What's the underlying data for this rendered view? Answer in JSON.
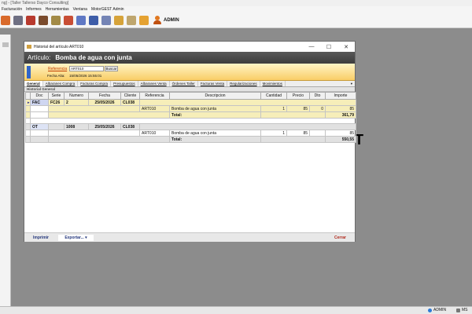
{
  "app": {
    "title_fragment": "ng] - [Taller Tallerso Dayco Consulting]",
    "menu": [
      "Facturación",
      "Informes",
      "Herramientas",
      "Ventana",
      "MotorGEST Admin"
    ],
    "user_label": "ADMIN",
    "background_letter": "T"
  },
  "statusbar": {
    "user": "ADMIN",
    "host": "MS"
  },
  "dialog": {
    "window_title": "Historial del artículo ART010",
    "controls": [
      "—",
      "☐",
      "✕"
    ],
    "article_label": "Artículo:",
    "article_name": "Bomba de agua con junta",
    "reference_label": "Referencia",
    "reference_value": "ART010",
    "search_label": "Buscar",
    "date_label": "Fecha Alta:",
    "date_value": "15/05/2026 15:55:01",
    "tabs": [
      "General",
      "Albaranes Compra",
      "Facturas Compra",
      "Presupuestos",
      "Albaranes Venta",
      "Órdenes Taller",
      "Facturas Venta",
      "Regularizaciones",
      "Movimientos"
    ],
    "tab_dropdown": "▾",
    "section_title": "Historial General",
    "columns": [
      "Doc",
      "Serie",
      "Numero",
      "Fecha",
      "Cliente",
      "Referencia",
      "Descripcion",
      "Cantidad",
      "Precio",
      "Dto",
      "Importe"
    ],
    "groups": [
      {
        "indicator": "▸",
        "doc": "FAC",
        "serie": "FC26",
        "numero": "2",
        "fecha": "25/05/2026",
        "cliente": "CL038",
        "line": {
          "referencia": "ART010",
          "descripcion": "Bomba de agua con junta",
          "cantidad": "1",
          "precio": "85",
          "dto": "0",
          "importe": "85"
        },
        "total_label": "Total:",
        "total": "361,79"
      },
      {
        "indicator": "",
        "doc": "OT",
        "serie": "",
        "numero": "1008",
        "fecha": "25/05/2026",
        "cliente": "CL038",
        "line": {
          "referencia": "ART010",
          "descripcion": "Bomba de agua con junta",
          "cantidad": "1",
          "precio": "85",
          "dto": "",
          "importe": "85"
        },
        "total_label": "Total:",
        "total": "550,55"
      }
    ],
    "footer": {
      "print": "Imprimir",
      "export": "Exportar... ▾",
      "close": "Cerrar"
    }
  },
  "colors": {
    "header_bg": "#4a4a4a",
    "ref_strip": "#f9cd67",
    "row_highlight": "#f6eeb9",
    "total_row": "#e1e1e1",
    "close": "#b12a1d"
  }
}
